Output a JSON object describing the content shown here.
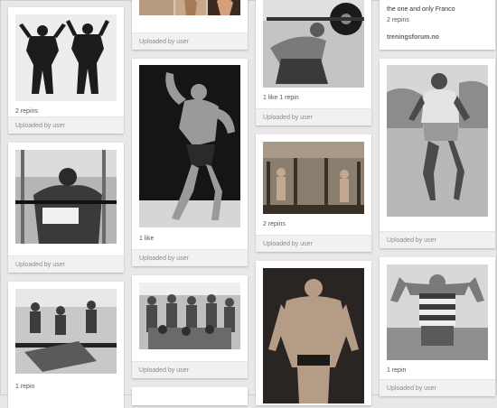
{
  "pins": [
    {
      "id": "p1",
      "stats": "",
      "footer": "Uploaded by user"
    },
    {
      "id": "p2",
      "stats": "2 repins",
      "footer": "Uploaded by user"
    },
    {
      "id": "p3",
      "stats": "",
      "footer": "Uploaded by user"
    },
    {
      "id": "p4",
      "stats": "1 repin",
      "footer": ""
    },
    {
      "id": "p5",
      "stats": "1 like",
      "footer": "Uploaded by user"
    },
    {
      "id": "p6",
      "stats": "",
      "footer": "Uploaded by user"
    },
    {
      "id": "p7",
      "stats": "1 like   1 repin",
      "footer": "Uploaded by user"
    },
    {
      "id": "p8",
      "stats": "2 repins",
      "footer": "Uploaded by user"
    },
    {
      "id": "p9",
      "stats": "",
      "footer": "Uploaded by user"
    },
    {
      "id": "p10",
      "caption": "the one and only Franco",
      "stats": "2 repins",
      "site": "treningsforum.no"
    },
    {
      "id": "p11",
      "stats": "",
      "footer": "Uploaded by user"
    },
    {
      "id": "p12",
      "stats": "1 repin",
      "footer": "Uploaded by user"
    }
  ]
}
